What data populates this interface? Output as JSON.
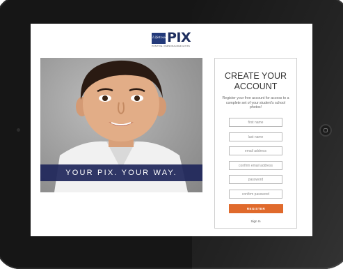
{
  "brand": {
    "script": "Lifetouch",
    "name_main": "PI",
    "name_x": "X",
    "tagline": "POSITIVE. PERSONALIZED & PIXS"
  },
  "hero": {
    "banner_text": "YOUR PIX. YOUR WAY."
  },
  "form": {
    "title_line1": "CREATE YOUR",
    "title_line2": "ACCOUNT",
    "description": "Register your free account for access to a complete set of your student's school photos!",
    "fields": [
      {
        "placeholder": "first name"
      },
      {
        "placeholder": "last name"
      },
      {
        "placeholder": "email address"
      },
      {
        "placeholder": "confirm email address"
      },
      {
        "placeholder": "password"
      },
      {
        "placeholder": "confirm password"
      }
    ],
    "register_label": "REGISTER",
    "signin_label": "Sign In"
  },
  "colors": {
    "accent": "#e06a2c",
    "brand_navy": "#1f2f5f",
    "device": "#161616"
  },
  "icons": {
    "home_button": "home-button-icon",
    "camera": "camera-icon"
  }
}
